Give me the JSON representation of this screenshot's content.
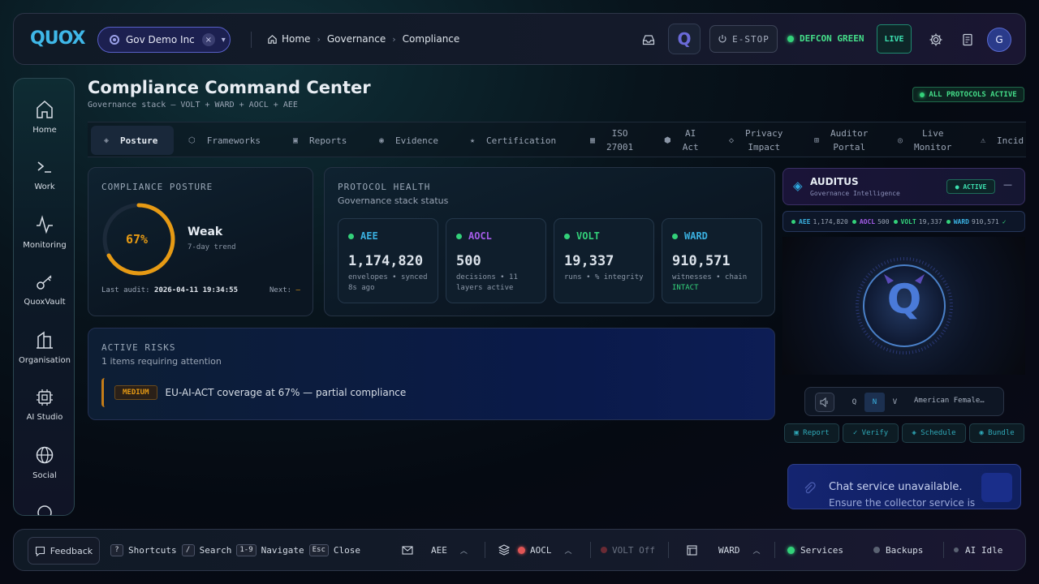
{
  "header": {
    "logo": "QUOX",
    "org_name": "Gov Demo Inc",
    "org_clear": "×",
    "breadcrumb": [
      "Home",
      "Governance",
      "Compliance"
    ],
    "estop_label": "E-STOP",
    "defcon_label": "DEFCON GREEN",
    "live_label": "LIVE",
    "avatar_initial": "G",
    "q_badge": "Q"
  },
  "sidebar": {
    "items": [
      {
        "label": "Home",
        "icon": "home-icon"
      },
      {
        "label": "Work",
        "icon": "terminal-icon"
      },
      {
        "label": "Monitoring",
        "icon": "pulse-icon"
      },
      {
        "label": "QuoxVault",
        "icon": "key-icon"
      },
      {
        "label": "Organisation",
        "icon": "building-icon"
      },
      {
        "label": "AI Studio",
        "icon": "chip-icon"
      },
      {
        "label": "Social",
        "icon": "globe-icon"
      }
    ]
  },
  "page": {
    "title": "Compliance Command Center",
    "subtitle": "Governance stack — VOLT + WARD + AOCL + AEE",
    "status_badge": "ALL PROTOCOLS ACTIVE"
  },
  "tabs": [
    {
      "icon": "◈",
      "label": "Posture",
      "active": true
    },
    {
      "icon": "⬡",
      "label": "Frameworks"
    },
    {
      "icon": "▣",
      "label": "Reports"
    },
    {
      "icon": "◉",
      "label": "Evidence"
    },
    {
      "icon": "★",
      "label": "Certification"
    },
    {
      "icon": "▦",
      "label1": "ISO",
      "label2": "27001"
    },
    {
      "icon": "⬢",
      "label1": "AI",
      "label2": "Act"
    },
    {
      "icon": "◇",
      "label1": "Privacy",
      "label2": "Impact"
    },
    {
      "icon": "⊞",
      "label1": "Auditor",
      "label2": "Portal"
    },
    {
      "icon": "◎",
      "label1": "Live",
      "label2": "Monitor"
    },
    {
      "icon": "⚠",
      "label": "Incid"
    }
  ],
  "posture": {
    "label": "COMPLIANCE POSTURE",
    "score_text": "67%",
    "score": 0.67,
    "rating": "Weak",
    "trend_label": "7-day trend",
    "last_audit_label": "Last audit:",
    "last_audit_value": "2026-04-11 19:34:55",
    "next_label": "Next:",
    "next_value": "—"
  },
  "protocol_health": {
    "label": "PROTOCOL HEALTH",
    "subtitle": "Governance stack status",
    "cards": [
      {
        "name": "AEE",
        "color": "#3ab0e0",
        "value": "1,174,820",
        "sub1": "envelopes • synced",
        "sub2": "8s ago"
      },
      {
        "name": "AOCL",
        "color": "#a45ce8",
        "value": "500",
        "sub1": "decisions • 11",
        "sub2": "layers active"
      },
      {
        "name": "VOLT",
        "color": "#33d17a",
        "value": "19,337",
        "sub1": "runs • % integrity",
        "sub2": ""
      },
      {
        "name": "WARD",
        "color": "#3ab0e0",
        "value": "910,571",
        "sub1": "witnesses • chain",
        "sub2": "INTACT"
      }
    ]
  },
  "risks": {
    "label": "ACTIVE RISKS",
    "subtitle": "1 items requiring attention",
    "items": [
      {
        "severity": "MEDIUM",
        "text": "EU-AI-ACT coverage at 67% — partial compliance"
      }
    ]
  },
  "auditus": {
    "title": "AUDITUS",
    "subtitle": "Governance Intelligence",
    "badge": "● ACTIVE",
    "minimize": "—",
    "stats": [
      {
        "name": "AEE",
        "value": "1,174,820",
        "color": "#3ab0e0"
      },
      {
        "name": "AOCL",
        "value": "500",
        "color": "#a45ce8"
      },
      {
        "name": "VOLT",
        "value": "19,337",
        "color": "#33d17a"
      },
      {
        "name": "WARD",
        "value": "910,571",
        "color": "#3ab0e0"
      }
    ],
    "stats_check": "✓",
    "orb_letter": "Q",
    "voice_modes": [
      "Q",
      "N",
      "V"
    ],
    "voice_name": "American Female…",
    "actions": [
      "▣ Report",
      "✓ Verify",
      "◈ Schedule",
      "◉ Bundle"
    ],
    "chat_title": "Chat service unavailable.",
    "chat_detail": "Ensure the collector service is"
  },
  "footer": {
    "feedback": "Feedback",
    "shortcuts": [
      {
        "key": "?",
        "label": "Shortcuts"
      },
      {
        "key": "/",
        "label": "Search"
      },
      {
        "key": "1-9",
        "label": "Navigate"
      },
      {
        "key": "Esc",
        "label": "Close"
      }
    ],
    "aee": "AEE",
    "aocl": "AOCL",
    "volt": "VOLT Off",
    "ward": "WARD",
    "services": "Services",
    "backups": "Backups",
    "ai": "AI Idle"
  }
}
